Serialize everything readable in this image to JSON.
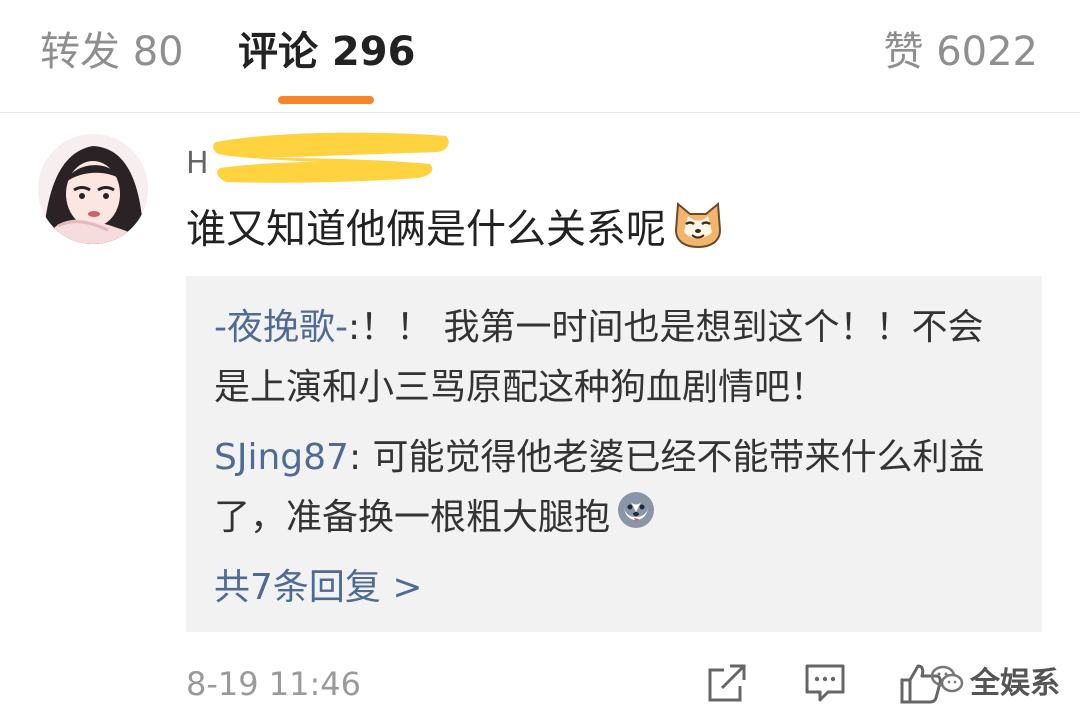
{
  "tabs": {
    "repost": "转发 80",
    "comments": "评论 296",
    "likes": "赞 6022",
    "active": "comments",
    "accent_color": "#f7862b"
  },
  "comment": {
    "username_visible": "H",
    "text": "谁又知道他俩是什么关系呢",
    "emoji": "cat-face-icon",
    "timestamp": "8-19 11:46"
  },
  "replies": [
    {
      "author": "-夜挽歌-",
      "text": ":！！ 我第一时间也是想到这个！！不会是上演和小三骂原配这种狗血剧情吧！"
    },
    {
      "author": "SJing87",
      "text": ": 可能觉得他老婆已经不能带来什么利益了，准备换一根粗大腿抱",
      "emoji": "husky-face-icon"
    }
  ],
  "more_replies": "共7条回复 >",
  "watermark": "全娱系",
  "colors": {
    "link": "#4f6b94",
    "reply_bg": "#f2f2f2",
    "muted": "#9a9a9a"
  }
}
